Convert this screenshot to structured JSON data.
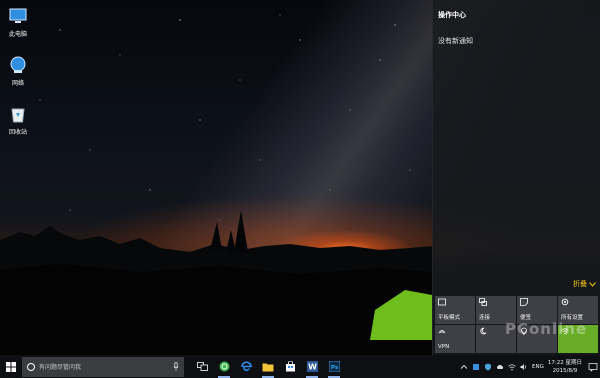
{
  "desktop": {
    "icons": [
      {
        "label": "此电脑",
        "icon": "this-pc-icon"
      },
      {
        "label": "网络",
        "icon": "network-icon"
      },
      {
        "label": "回收站",
        "icon": "recycle-bin-icon"
      }
    ]
  },
  "action_center": {
    "title": "操作中心",
    "empty_message": "没有新通知",
    "collapse_label": "折叠",
    "tiles": [
      {
        "label": "平板模式",
        "icon": "tablet-mode-icon"
      },
      {
        "label": "连接",
        "icon": "connect-icon"
      },
      {
        "label": "便签",
        "icon": "note-icon"
      },
      {
        "label": "所有设置",
        "icon": "settings-gear-icon"
      },
      {
        "label": "VPN",
        "icon": "vpn-icon"
      },
      {
        "label": "",
        "icon": "quiet-hours-moon-icon"
      },
      {
        "label": "",
        "icon": "location-icon"
      },
      {
        "label": "",
        "icon": "wifi-icon",
        "active": true
      }
    ],
    "accent_color": "#f1c40f"
  },
  "taskbar": {
    "search_placeholder": "有问题尽管问我",
    "apps": [
      "task-view-icon",
      "360-browser-icon",
      "edge-icon",
      "file-explorer-icon",
      "store-icon",
      "word-icon",
      "photoshop-icon"
    ],
    "language": "ENG",
    "time": "17:22 星期日",
    "date": "2015/8/9"
  },
  "watermark_text": "PConline"
}
